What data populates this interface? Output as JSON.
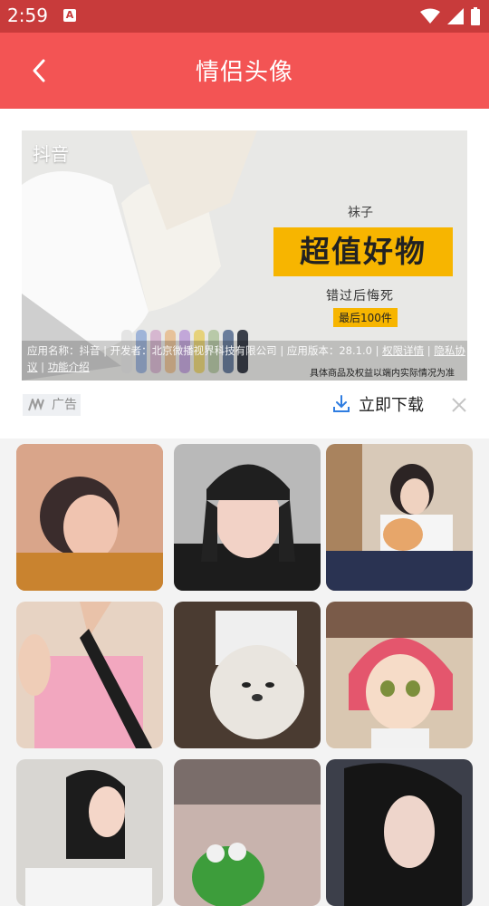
{
  "status_bar": {
    "time": "2:59",
    "notification_icon_letter": "A",
    "icons": [
      "wifi-icon",
      "signal-icon",
      "battery-icon"
    ]
  },
  "app_bar": {
    "title": "情侣头像",
    "back_icon": "chevron-left-icon",
    "background_color": "#f35454"
  },
  "ad": {
    "app_name": "抖音",
    "tag_small": "袜子",
    "headline": "超值好物",
    "sub_text": "错过后悔死",
    "badge": "最后100件",
    "info_part1": "应用名称：抖音 | 开发者：北京微播视界科技有限公司 | 应用版本：28.1.0 | ",
    "permission_link": "权限详情",
    "separator": " | ",
    "privacy_link": "隐私协议",
    "function_link": "功能介绍",
    "disclaimer": "具体商品及权益以端内实际情况为准",
    "label": "广告",
    "download_label": "立即下载",
    "download_icon": "download-icon",
    "close_icon": "close-icon"
  },
  "avatars": [
    {
      "name": "avatar-tile"
    },
    {
      "name": "avatar-tile"
    },
    {
      "name": "avatar-tile"
    },
    {
      "name": "avatar-tile"
    },
    {
      "name": "avatar-tile"
    },
    {
      "name": "avatar-tile"
    },
    {
      "name": "avatar-tile"
    },
    {
      "name": "avatar-tile"
    },
    {
      "name": "avatar-tile"
    }
  ]
}
